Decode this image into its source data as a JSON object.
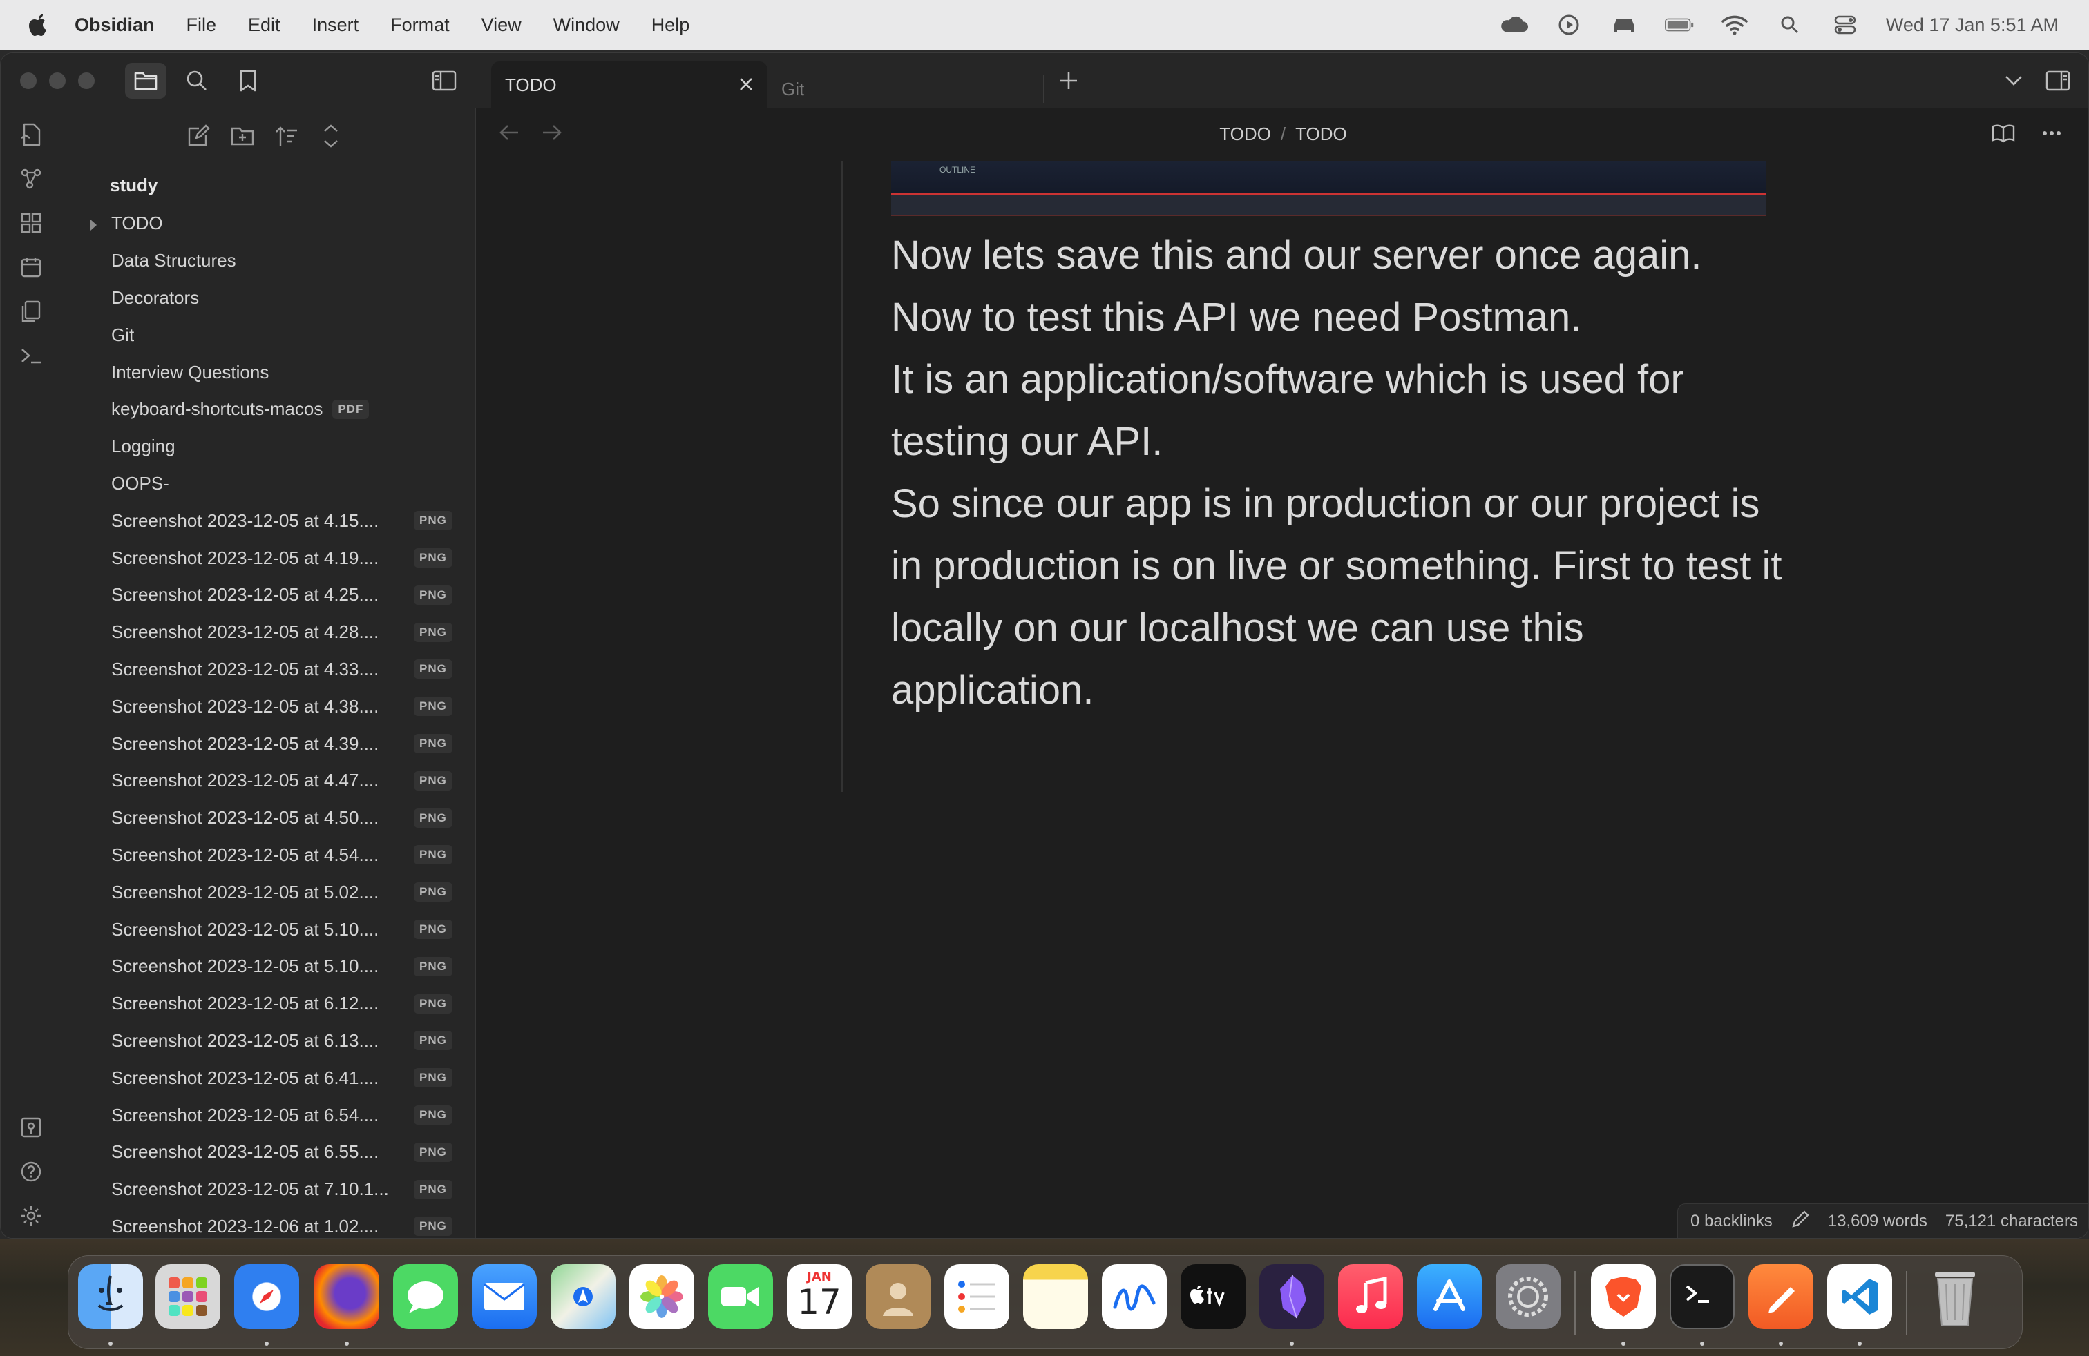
{
  "menubar": {
    "app_name": "Obsidian",
    "items": [
      "File",
      "Edit",
      "Insert",
      "Format",
      "View",
      "Window",
      "Help"
    ],
    "clock": "Wed 17 Jan  5:51 AM",
    "status_icons": [
      "cloud-icon",
      "play-icon",
      "car-icon",
      "battery-icon",
      "wifi-icon",
      "search-icon",
      "control-center-icon"
    ]
  },
  "tabs": [
    {
      "label": "TODO",
      "active": true
    },
    {
      "label": "Git",
      "active": false
    }
  ],
  "sidebar": {
    "root": "study",
    "items": [
      {
        "label": "TODO",
        "folder": true
      },
      {
        "label": "Data Structures"
      },
      {
        "label": "Decorators"
      },
      {
        "label": "Git"
      },
      {
        "label": "Interview Questions"
      },
      {
        "label": "keyboard-shortcuts-macos",
        "badge": "PDF"
      },
      {
        "label": "Logging"
      },
      {
        "label": "OOPS-"
      },
      {
        "label": "Screenshot 2023-12-05 at 4.15....",
        "badge": "PNG"
      },
      {
        "label": "Screenshot 2023-12-05 at 4.19....",
        "badge": "PNG"
      },
      {
        "label": "Screenshot 2023-12-05 at 4.25....",
        "badge": "PNG"
      },
      {
        "label": "Screenshot 2023-12-05 at 4.28....",
        "badge": "PNG"
      },
      {
        "label": "Screenshot 2023-12-05 at 4.33....",
        "badge": "PNG"
      },
      {
        "label": "Screenshot 2023-12-05 at 4.38....",
        "badge": "PNG"
      },
      {
        "label": "Screenshot 2023-12-05 at 4.39....",
        "badge": "PNG"
      },
      {
        "label": "Screenshot 2023-12-05 at 4.47....",
        "badge": "PNG"
      },
      {
        "label": "Screenshot 2023-12-05 at 4.50....",
        "badge": "PNG"
      },
      {
        "label": "Screenshot 2023-12-05 at 4.54....",
        "badge": "PNG"
      },
      {
        "label": "Screenshot 2023-12-05 at 5.02....",
        "badge": "PNG"
      },
      {
        "label": "Screenshot 2023-12-05 at 5.10....",
        "badge": "PNG"
      },
      {
        "label": "Screenshot 2023-12-05 at 5.10....",
        "badge": "PNG"
      },
      {
        "label": "Screenshot 2023-12-05 at 6.12....",
        "badge": "PNG"
      },
      {
        "label": "Screenshot 2023-12-05 at 6.13....",
        "badge": "PNG"
      },
      {
        "label": "Screenshot 2023-12-05 at 6.41....",
        "badge": "PNG"
      },
      {
        "label": "Screenshot 2023-12-05 at 6.54....",
        "badge": "PNG"
      },
      {
        "label": "Screenshot 2023-12-05 at 6.55....",
        "badge": "PNG"
      },
      {
        "label": "Screenshot 2023-12-05 at 7.10.1...",
        "badge": "PNG"
      },
      {
        "label": "Screenshot 2023-12-06 at 1.02....",
        "badge": "PNG"
      }
    ]
  },
  "editor": {
    "breadcrumb": [
      "TODO",
      "TODO"
    ],
    "embed_label": "OUTLINE",
    "paragraphs": [
      "Now lets save this and our server once again.",
      "Now to test this API we need Postman.",
      "It is an application/software which is used for testing our API.",
      "So since our app is in production or our project is in production is on live or something. First to test it locally on our localhost we can use this application."
    ]
  },
  "statusbar": {
    "backlinks": "0 backlinks",
    "words": "13,609 words",
    "characters": "75,121 characters"
  },
  "dock": {
    "calendar_month": "JAN",
    "calendar_day": "17",
    "apps": [
      "finder",
      "launchpad",
      "safari",
      "firefox",
      "messages",
      "mail",
      "maps",
      "photos",
      "facetime",
      "calendar",
      "contacts",
      "reminders",
      "notes",
      "freeform",
      "tv",
      "obsidian",
      "music",
      "app-store",
      "system-settings",
      "brave",
      "terminal",
      "sketch",
      "vscode",
      "trash"
    ]
  },
  "colors": {
    "background": "#1e1e1e",
    "sidebar": "#262626",
    "text": "#dadada",
    "menubar": "#e9e9ea"
  }
}
